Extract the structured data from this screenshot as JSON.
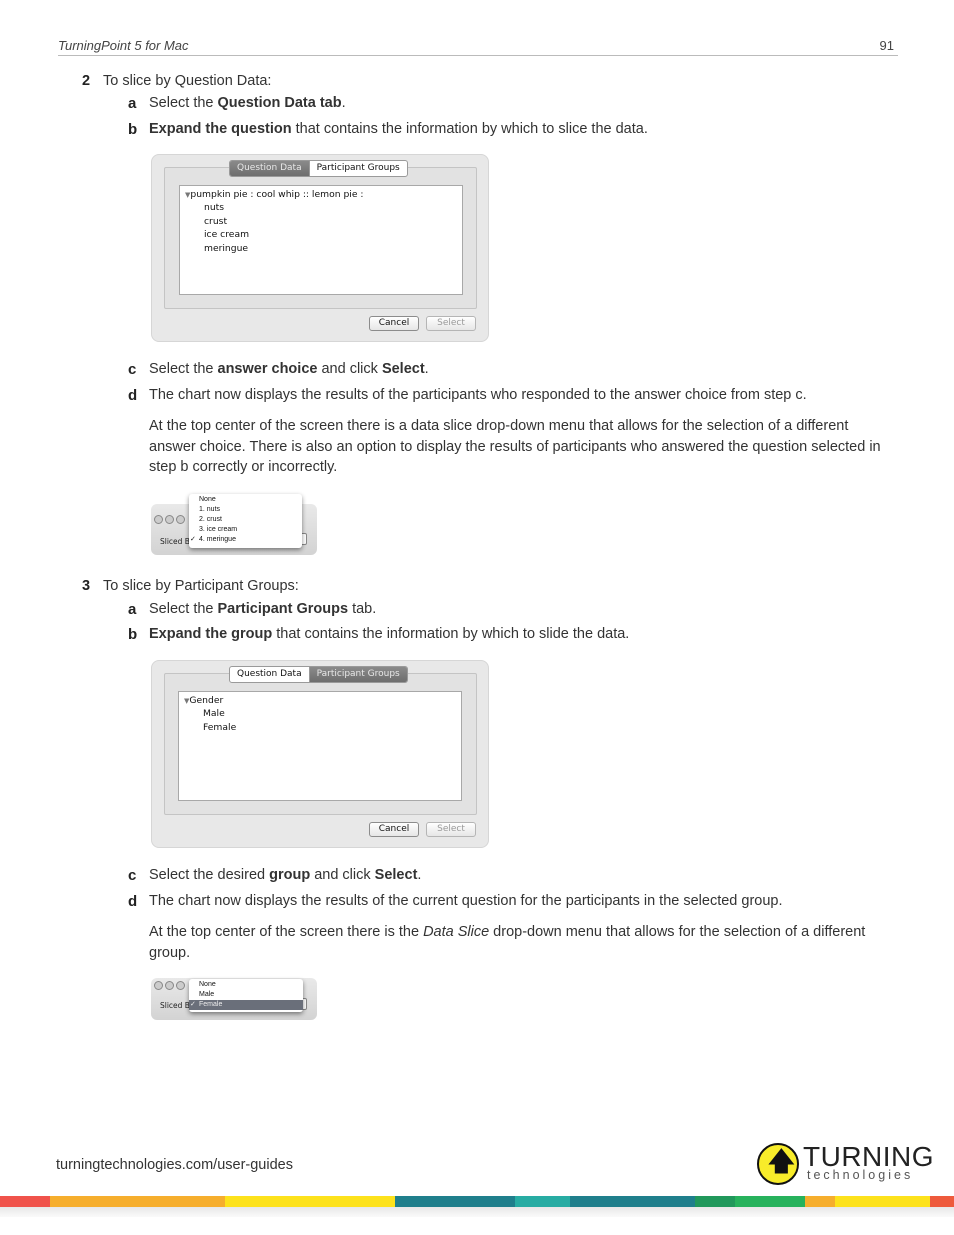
{
  "header": {
    "title": "TurningPoint 5 for Mac",
    "page_number": "91"
  },
  "step2": {
    "number": "2",
    "text": "To slice by Question Data:",
    "a": {
      "letter": "a",
      "pre": "Select the ",
      "bold": "Question Data tab",
      "post": "."
    },
    "b": {
      "letter": "b",
      "bold": "Expand the question",
      "post": " that contains the information by which to slice the data."
    },
    "dialog": {
      "tabs": [
        "Question Data",
        "Participant Groups"
      ],
      "active_tab": "Question Data",
      "root": "pumpkin pie : cool whip :: lemon pie :",
      "items": [
        "nuts",
        "crust",
        "ice cream",
        "meringue"
      ],
      "cancel_label": "Cancel",
      "select_label": "Select"
    },
    "c": {
      "letter": "c",
      "pre": "Select the ",
      "bold1": "answer choice",
      "mid": " and click ",
      "bold2": "Select",
      "post": "."
    },
    "d": {
      "letter": "d",
      "text": "The chart now displays the results of the participants who responded to the answer choice from step c."
    },
    "para": "At the top center of the screen there is a data slice drop-down menu that allows for the selection of a different answer choice. There is also an option to display the results of participants who answered the question selected in step b correctly or incorrectly.",
    "dropdown": {
      "label": "Sliced By",
      "options": [
        "None",
        "1. nuts",
        "2. crust",
        "3. ice cream",
        "4. meringue"
      ],
      "checked": "4. meringue"
    }
  },
  "step3": {
    "number": "3",
    "text": "To slice by Participant Groups:",
    "a": {
      "letter": "a",
      "pre": "Select the ",
      "bold": "Participant Groups",
      "post": " tab."
    },
    "b": {
      "letter": "b",
      "bold": "Expand the group",
      "post": " that contains the information by which to slide the data."
    },
    "dialog": {
      "tabs": [
        "Question Data",
        "Participant Groups"
      ],
      "active_tab": "Participant Groups",
      "root": "Gender",
      "items": [
        "Male",
        "Female"
      ],
      "cancel_label": "Cancel",
      "select_label": "Select"
    },
    "c": {
      "letter": "c",
      "pre": "Select the desired ",
      "bold1": "group",
      "mid": " and click ",
      "bold2": "Select",
      "post": "."
    },
    "d": {
      "letter": "d",
      "text": "The chart now displays the results of the current question for the participants in the selected group."
    },
    "para_pre": "At the top center of the screen there is the ",
    "para_em": "Data Slice",
    "para_post": " drop-down menu that allows for the selection of a different group.",
    "dropdown": {
      "label": "Sliced By",
      "options": [
        "None",
        "Male",
        "Female"
      ],
      "checked": "Female"
    }
  },
  "footer": {
    "url": "turningtechnologies.com/user-guides",
    "logo_top": "TURNING",
    "logo_bottom": "technologies",
    "band_colors": [
      "#f0534b",
      "#f6ae2d",
      "#fde21c",
      "#1f7f8c",
      "#27aca3",
      "#1f7f8c",
      "#21985b",
      "#27b25c",
      "#f6ae2d",
      "#fde21c",
      "#ee5a3c"
    ]
  }
}
